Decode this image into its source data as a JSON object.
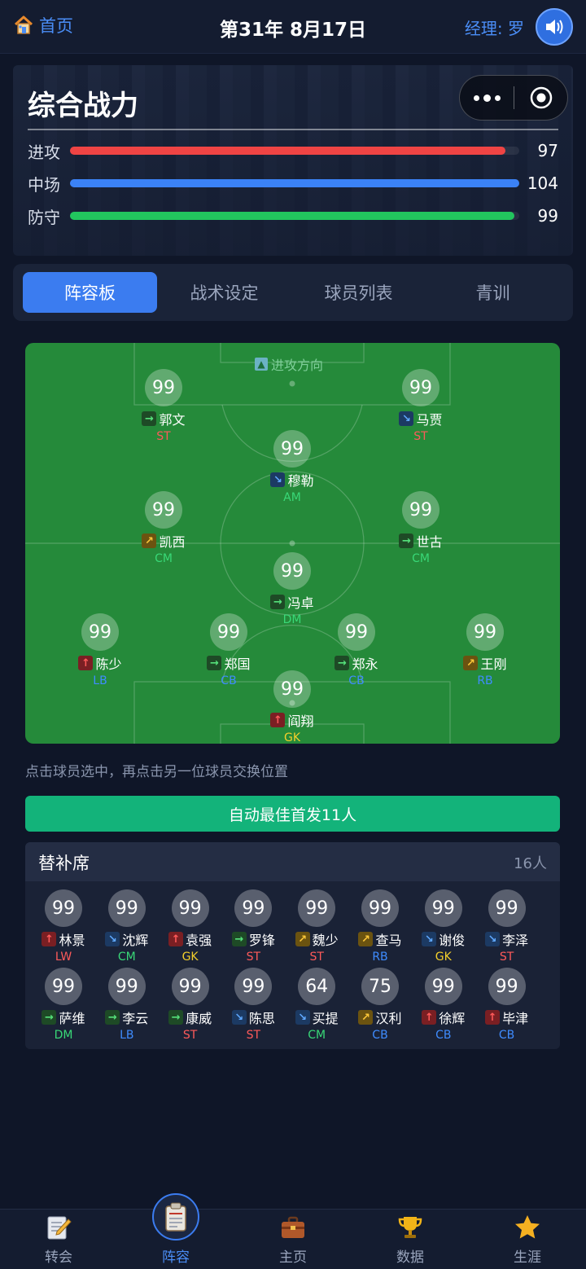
{
  "header": {
    "home_label": "首页",
    "date": "第31年 8月17日",
    "manager": "经理: 罗"
  },
  "power": {
    "title": "综合战力",
    "stats": [
      {
        "label": "进攻",
        "value": "97",
        "fill": 0.97,
        "color": "#ef4444"
      },
      {
        "label": "中场",
        "value": "104",
        "fill": 1.0,
        "color": "#3b82f6"
      },
      {
        "label": "防守",
        "value": "99",
        "fill": 0.99,
        "color": "#22c55e"
      }
    ]
  },
  "tabs": [
    "阵容板",
    "战术设定",
    "球员列表",
    "青训"
  ],
  "pitch": {
    "attack_direction": "进攻方向",
    "players": [
      {
        "rating": "99",
        "name": "郭文",
        "trend": "flat",
        "pos": "ST"
      },
      {
        "rating": "99",
        "name": "马贾",
        "trend": "fall",
        "pos": "ST"
      },
      {
        "rating": "99",
        "name": "穆勒",
        "trend": "fall",
        "pos": "AM"
      },
      {
        "rating": "99",
        "name": "凯西",
        "trend": "rise",
        "pos": "CM"
      },
      {
        "rating": "99",
        "name": "世古",
        "trend": "flat",
        "pos": "CM"
      },
      {
        "rating": "99",
        "name": "冯卓",
        "trend": "flat",
        "pos": "DM"
      },
      {
        "rating": "99",
        "name": "陈少",
        "trend": "up",
        "pos": "LB"
      },
      {
        "rating": "99",
        "name": "郑国",
        "trend": "flat",
        "pos": "CB"
      },
      {
        "rating": "99",
        "name": "郑永",
        "trend": "flat",
        "pos": "CB"
      },
      {
        "rating": "99",
        "name": "王刚",
        "trend": "rise",
        "pos": "RB"
      },
      {
        "rating": "99",
        "name": "阎翔",
        "trend": "up",
        "pos": "GK"
      }
    ]
  },
  "hint": "点击球员选中，再点击另一位球员交换位置",
  "auto_button": "自动最佳首发11人",
  "bench": {
    "title": "替补席",
    "count": "16人",
    "players": [
      {
        "rating": "99",
        "name": "林景",
        "trend": "up",
        "pos": "LW"
      },
      {
        "rating": "99",
        "name": "沈辉",
        "trend": "fall",
        "pos": "CM"
      },
      {
        "rating": "99",
        "name": "袁强",
        "trend": "up",
        "pos": "GK"
      },
      {
        "rating": "99",
        "name": "罗锋",
        "trend": "flat",
        "pos": "ST"
      },
      {
        "rating": "99",
        "name": "魏少",
        "trend": "rise",
        "pos": "ST"
      },
      {
        "rating": "99",
        "name": "查马",
        "trend": "rise",
        "pos": "RB"
      },
      {
        "rating": "99",
        "name": "谢俊",
        "trend": "fall",
        "pos": "GK"
      },
      {
        "rating": "99",
        "name": "李泽",
        "trend": "fall",
        "pos": "ST"
      },
      {
        "rating": "99",
        "name": "萨维",
        "trend": "flat",
        "pos": "DM"
      },
      {
        "rating": "99",
        "name": "李云",
        "trend": "flat",
        "pos": "LB"
      },
      {
        "rating": "99",
        "name": "康威",
        "trend": "flat",
        "pos": "ST"
      },
      {
        "rating": "99",
        "name": "陈思",
        "trend": "fall",
        "pos": "ST"
      },
      {
        "rating": "64",
        "name": "买提",
        "trend": "fall",
        "pos": "CM"
      },
      {
        "rating": "75",
        "name": "汉利",
        "trend": "rise",
        "pos": "CB"
      },
      {
        "rating": "99",
        "name": "徐辉",
        "trend": "up",
        "pos": "CB"
      },
      {
        "rating": "99",
        "name": "毕津",
        "trend": "up",
        "pos": "CB"
      }
    ]
  },
  "nav": [
    {
      "label": "转会",
      "icon": "notepad-pencil-icon"
    },
    {
      "label": "阵容",
      "icon": "clipboard-icon"
    },
    {
      "label": "主页",
      "icon": "briefcase-icon"
    },
    {
      "label": "数据",
      "icon": "trophy-icon"
    },
    {
      "label": "生涯",
      "icon": "star-icon"
    }
  ],
  "active_nav": 1,
  "active_tab": 0
}
